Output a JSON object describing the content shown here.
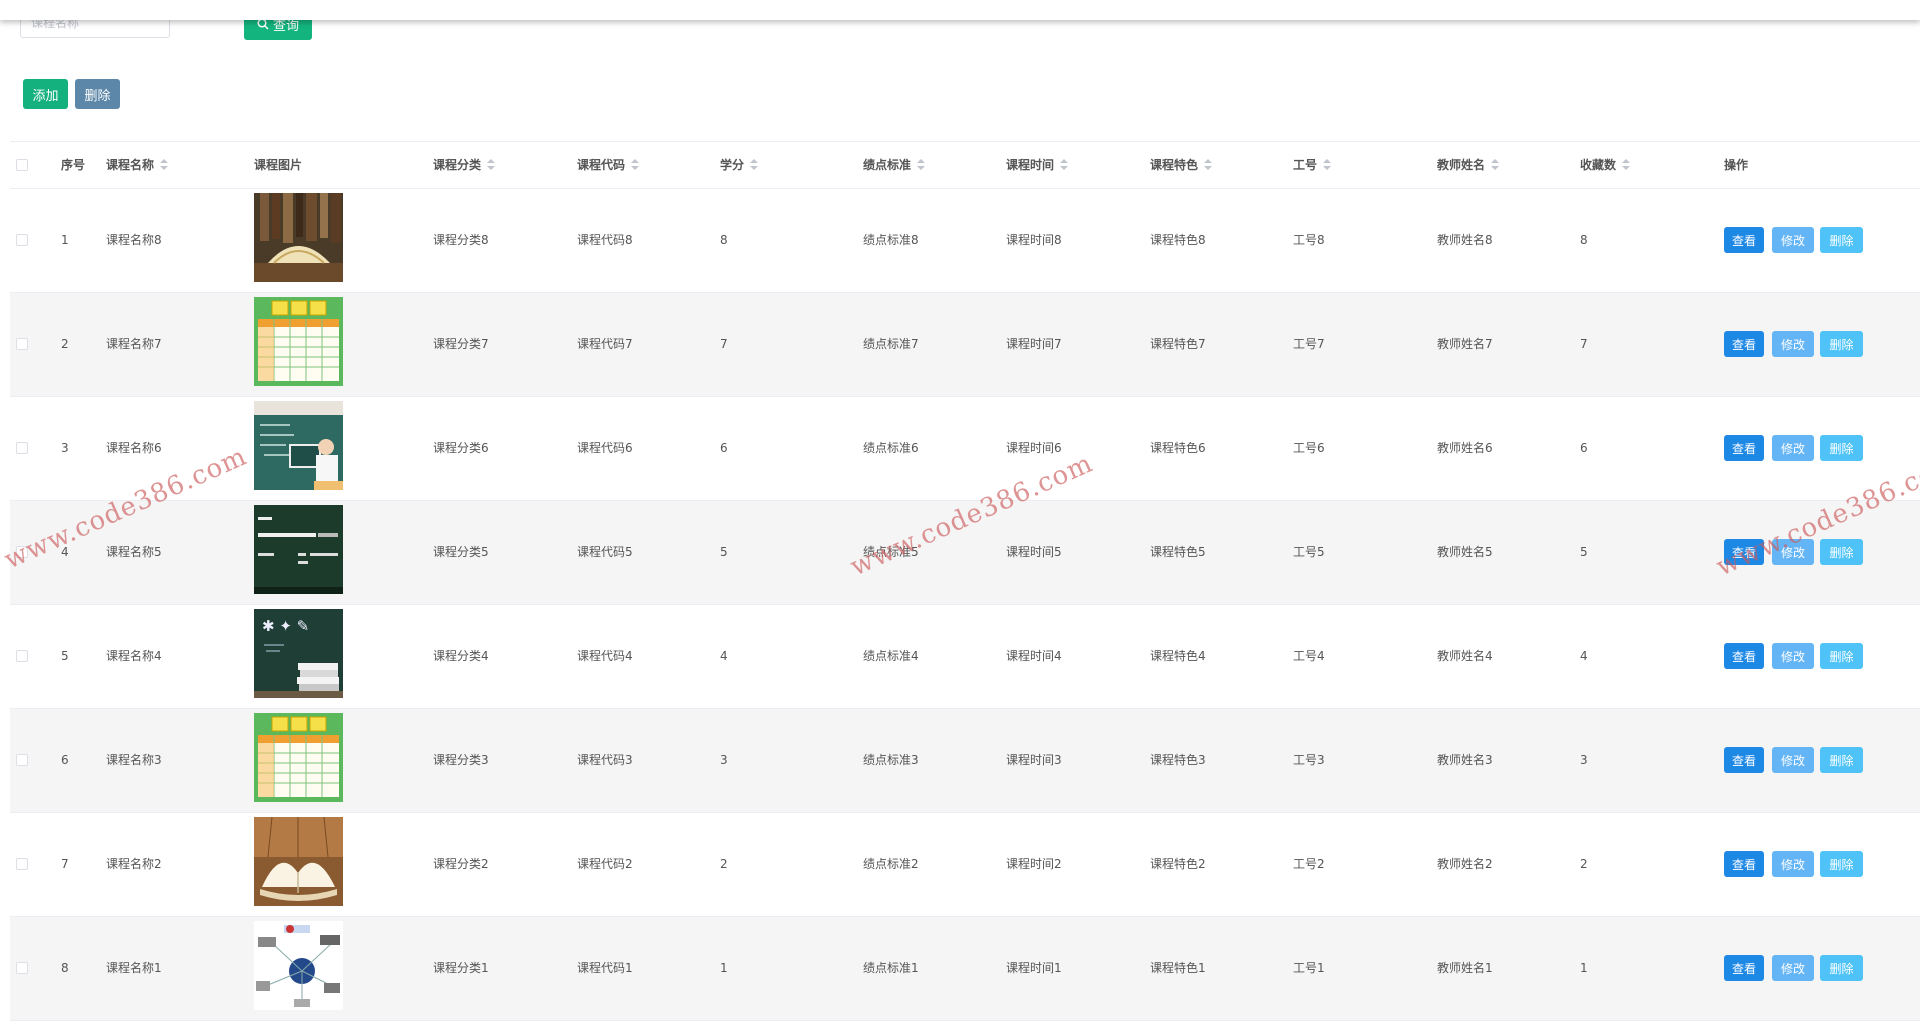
{
  "search": {
    "placeholder": "课程名称",
    "query_label": "查询"
  },
  "toolbar": {
    "add_label": "添加",
    "delete_label": "删除"
  },
  "table": {
    "columns": [
      "序号",
      "课程名称",
      "课程图片",
      "课程分类",
      "课程代码",
      "学分",
      "绩点标准",
      "课程时间",
      "课程特色",
      "工号",
      "教师姓名",
      "收藏数",
      "操作"
    ],
    "actions": {
      "view": "查看",
      "edit": "修改",
      "delete": "删除"
    },
    "rows": [
      {
        "idx": "1",
        "name": "课程名称8",
        "category": "课程分类8",
        "code": "课程代码8",
        "credit": "8",
        "gpa": "绩点标准8",
        "time": "课程时间8",
        "feature": "课程特色8",
        "job_no": "工号8",
        "teacher": "教师姓名8",
        "favorites": "8",
        "image": "books-photo"
      },
      {
        "idx": "2",
        "name": "课程名称7",
        "category": "课程分类7",
        "code": "课程代码7",
        "credit": "7",
        "gpa": "绩点标准7",
        "time": "课程时间7",
        "feature": "课程特色7",
        "job_no": "工号7",
        "teacher": "教师姓名7",
        "favorites": "7",
        "image": "timetable-graphic"
      },
      {
        "idx": "3",
        "name": "课程名称6",
        "category": "课程分类6",
        "code": "课程代码6",
        "credit": "6",
        "gpa": "绩点标准6",
        "time": "课程时间6",
        "feature": "课程特色6",
        "job_no": "工号6",
        "teacher": "教师姓名6",
        "favorites": "6",
        "image": "blackboard-student-photo"
      },
      {
        "idx": "4",
        "name": "课程名称5",
        "category": "课程分类5",
        "code": "课程代码5",
        "credit": "5",
        "gpa": "绩点标准5",
        "time": "课程时间5",
        "feature": "课程特色5",
        "job_no": "工号5",
        "teacher": "教师姓名5",
        "favorites": "5",
        "image": "slide-screenshot"
      },
      {
        "idx": "5",
        "name": "课程名称4",
        "category": "课程分类4",
        "code": "课程代码4",
        "credit": "4",
        "gpa": "绩点标准4",
        "time": "课程时间4",
        "feature": "课程特色4",
        "job_no": "工号4",
        "teacher": "教师姓名4",
        "favorites": "4",
        "image": "chalkboard-books-photo"
      },
      {
        "idx": "6",
        "name": "课程名称3",
        "category": "课程分类3",
        "code": "课程代码3",
        "credit": "3",
        "gpa": "绩点标准3",
        "time": "课程时间3",
        "feature": "课程特色3",
        "job_no": "工号3",
        "teacher": "教师姓名3",
        "favorites": "3",
        "image": "timetable-graphic"
      },
      {
        "idx": "7",
        "name": "课程名称2",
        "category": "课程分类2",
        "code": "课程代码2",
        "credit": "2",
        "gpa": "绩点标准2",
        "time": "课程时间2",
        "feature": "课程特色2",
        "job_no": "工号2",
        "teacher": "教师姓名2",
        "favorites": "2",
        "image": "open-book-photo"
      },
      {
        "idx": "8",
        "name": "课程名称1",
        "category": "课程分类1",
        "code": "课程代码1",
        "credit": "1",
        "gpa": "绩点标准1",
        "time": "课程时间1",
        "feature": "课程特色1",
        "job_no": "工号1",
        "teacher": "教师姓名1",
        "favorites": "1",
        "image": "mindmap-diagram"
      }
    ]
  },
  "watermark": "www.code386.com",
  "colors": {
    "primary": "#13b47e",
    "view": "#1e88e5",
    "edit": "#64b5f6",
    "delete": "#4fc3f7",
    "batch_delete": "#5d87a8"
  }
}
